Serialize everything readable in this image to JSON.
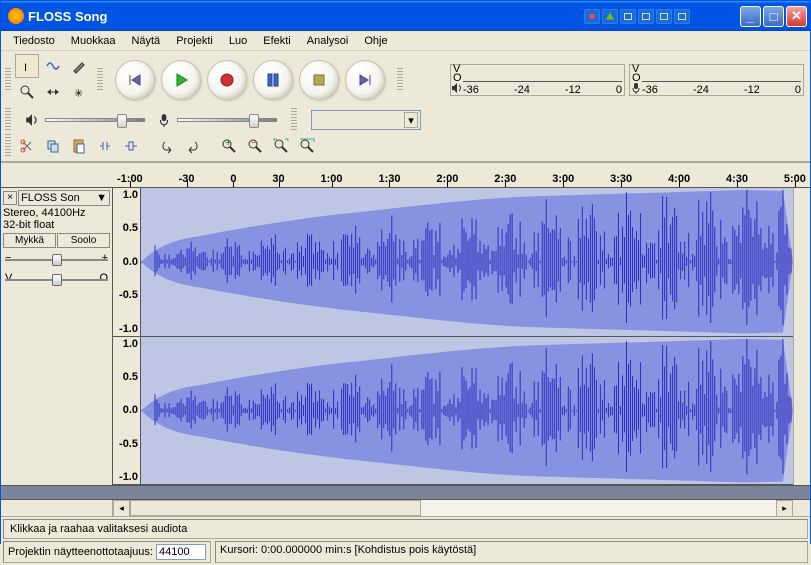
{
  "titlebar": {
    "title": "FLOSS Song"
  },
  "menu": {
    "file": "Tiedosto",
    "edit": "Muokkaa",
    "view": "Näytä",
    "project": "Projekti",
    "generate": "Luo",
    "effect": "Efekti",
    "analyze": "Analysoi",
    "help": "Ohje"
  },
  "meter": {
    "l": "V",
    "r": "O",
    "ticks": [
      "-36",
      "-24",
      "-12",
      "0"
    ]
  },
  "timeline": {
    "ticks": [
      "-1:00",
      "-30",
      "0",
      "30",
      "1:00",
      "1:30",
      "2:00",
      "2:30",
      "3:00",
      "3:30",
      "4:00",
      "4:30",
      "5:00"
    ]
  },
  "track": {
    "name": "FLOSS Son",
    "stereo": "Stereo, 44100Hz",
    "format": "32-bit float",
    "mute": "Mykkä",
    "solo": "Soolo",
    "pan_l": "V",
    "pan_r": "O"
  },
  "ruler": [
    "1.0",
    "0.5",
    "0.0",
    "-0.5",
    "-1.0"
  ],
  "status": {
    "hint": "Klikkaa ja raahaa valitaksesi audiota",
    "rate_label": "Projektin näytteenottotaajuus:",
    "rate_value": "44100",
    "cursor": "Kursori: 0:00.000000 min:s  [Kohdistus pois käytöstä]"
  }
}
